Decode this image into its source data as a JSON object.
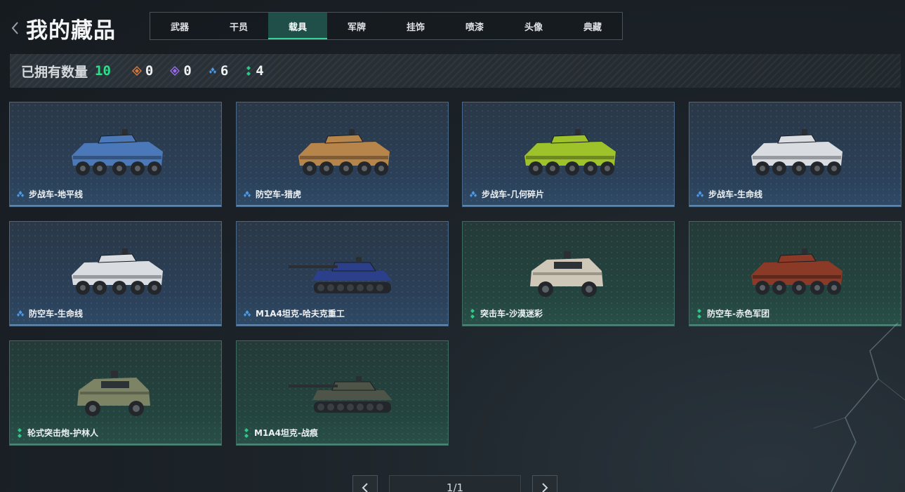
{
  "header": {
    "title": "我的藏品",
    "tabs": [
      {
        "label": "武器",
        "active": false
      },
      {
        "label": "干员",
        "active": false
      },
      {
        "label": "载具",
        "active": true
      },
      {
        "label": "军牌",
        "active": false
      },
      {
        "label": "挂饰",
        "active": false
      },
      {
        "label": "喷漆",
        "active": false
      },
      {
        "label": "头像",
        "active": false
      },
      {
        "label": "典藏",
        "active": false
      }
    ]
  },
  "stats": {
    "owned_label": "已拥有数量",
    "owned_count": "10",
    "rarities": [
      {
        "icon": "orange-diamond-icon",
        "color": "#d9793a",
        "count": "0"
      },
      {
        "icon": "purple-diamond-icon",
        "color": "#9a6cf0",
        "count": "0"
      },
      {
        "icon": "blue-diamond-icon",
        "color": "#4c9be8",
        "count": "6"
      },
      {
        "icon": "green-diamond-icon",
        "color": "#2ec98a",
        "count": "4"
      }
    ]
  },
  "items": [
    {
      "name": "步战车-地平线",
      "rarity": "blue",
      "vehicle": "wheeled-apc",
      "paint": "#4a78b8"
    },
    {
      "name": "防空车-猎虎",
      "rarity": "blue",
      "vehicle": "wheeled-apc",
      "paint": "#b7844a"
    },
    {
      "name": "步战车-几何碎片",
      "rarity": "blue",
      "vehicle": "wheeled-apc",
      "paint": "#9ec32a"
    },
    {
      "name": "步战车-生命线",
      "rarity": "blue",
      "vehicle": "wheeled-apc",
      "paint": "#d9dde2"
    },
    {
      "name": "防空车-生命线",
      "rarity": "blue",
      "vehicle": "wheeled-apc",
      "paint": "#d9dde2"
    },
    {
      "name": "M1A4坦克-哈夫克重工",
      "rarity": "blue",
      "vehicle": "tank",
      "paint": "#2c3f8a"
    },
    {
      "name": "突击车-沙漠迷彩",
      "rarity": "green",
      "vehicle": "armored-car",
      "paint": "#cfc8b8"
    },
    {
      "name": "防空车-赤色军团",
      "rarity": "green",
      "vehicle": "wheeled-apc",
      "paint": "#8a3a26"
    },
    {
      "name": "轮式突击炮-护林人",
      "rarity": "green",
      "vehicle": "armored-car",
      "paint": "#7d8466"
    },
    {
      "name": "M1A4坦克-战痕",
      "rarity": "green",
      "vehicle": "tank",
      "paint": "#4e5548"
    }
  ],
  "pager": {
    "indicator": "1/1"
  }
}
